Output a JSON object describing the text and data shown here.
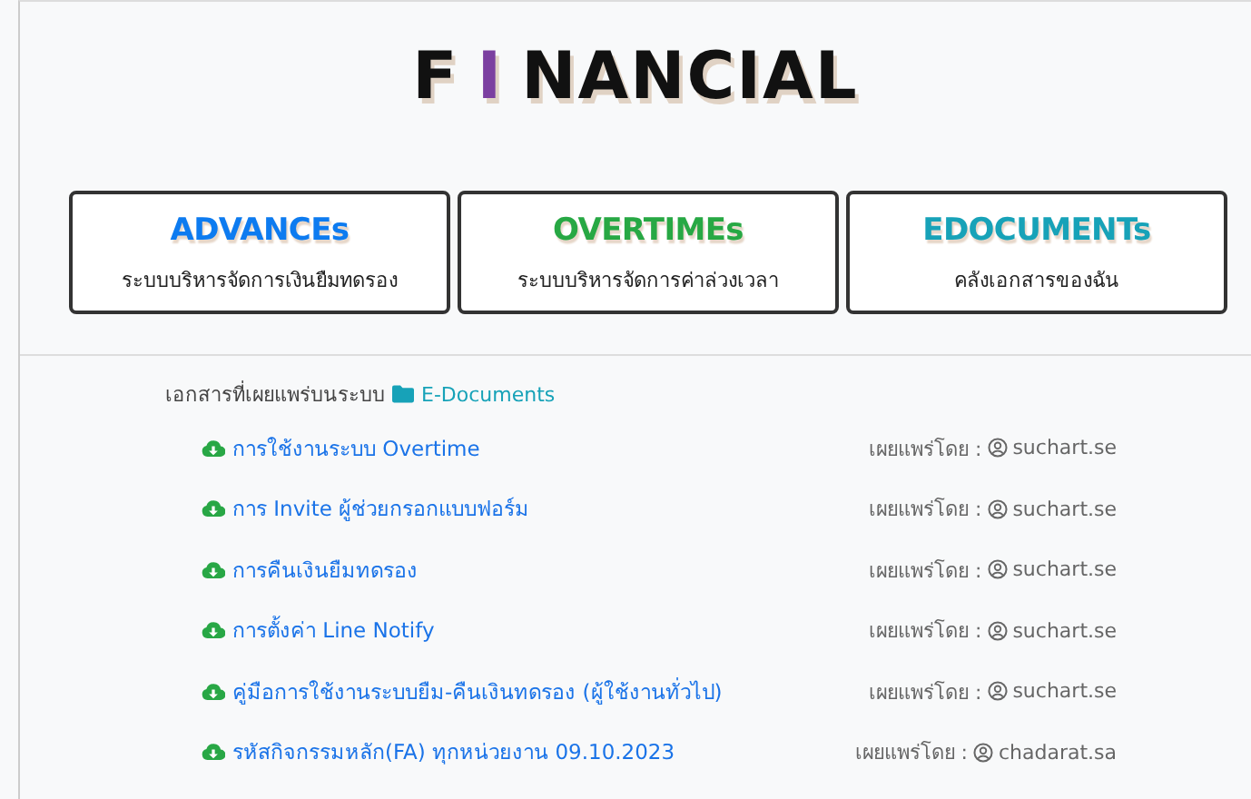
{
  "logo": [
    {
      "text": "F",
      "color": "#111111"
    },
    {
      "text": "I",
      "color": "#7b3fa0"
    },
    {
      "text": "NANCIAL",
      "color": "#111111"
    }
  ],
  "cards": [
    {
      "title": "ADVANCEs",
      "subtitle": "ระบบบริหารจัดการเงินยืมทดรอง",
      "color": "#0d7bf0"
    },
    {
      "title": "OVERTIMEs",
      "subtitle": "ระบบบริหารจัดการค่าล่วงเวลา",
      "color": "#27a844"
    },
    {
      "title": "EDOCUMENTs",
      "subtitle": "คลังเอกสารของฉัน",
      "color": "#17a2b8"
    }
  ],
  "documents": {
    "heading": "เอกสารที่เผยแพร่บนระบบ",
    "folder": "E-Documents",
    "items": [
      {
        "title": "การใช้งานระบบ Overtime",
        "published_by": "เผยแพร่โดย :",
        "author": "suchart.se"
      },
      {
        "title": "การ Invite ผู้ช่วยกรอกแบบฟอร์ม",
        "published_by": "เผยแพร่โดย :",
        "author": "suchart.se"
      },
      {
        "title": "การคืนเงินยืมทดรอง",
        "published_by": "เผยแพร่โดย :",
        "author": "suchart.se"
      },
      {
        "title": "การตั้งค่า Line Notify",
        "published_by": "เผยแพร่โดย :",
        "author": "suchart.se"
      },
      {
        "title": "คู่มือการใช้งานระบบยืม-คืนเงินทดรอง (ผู้ใช้งานทั่วไป)",
        "published_by": "เผยแพร่โดย :",
        "author": "suchart.se"
      },
      {
        "title": "รหัสกิจกรรมหลัก(FA) ทุกหน่วยงาน 09.10.2023",
        "published_by": "เผยแพร่โดย :",
        "author": "chadarat.sa"
      }
    ]
  }
}
